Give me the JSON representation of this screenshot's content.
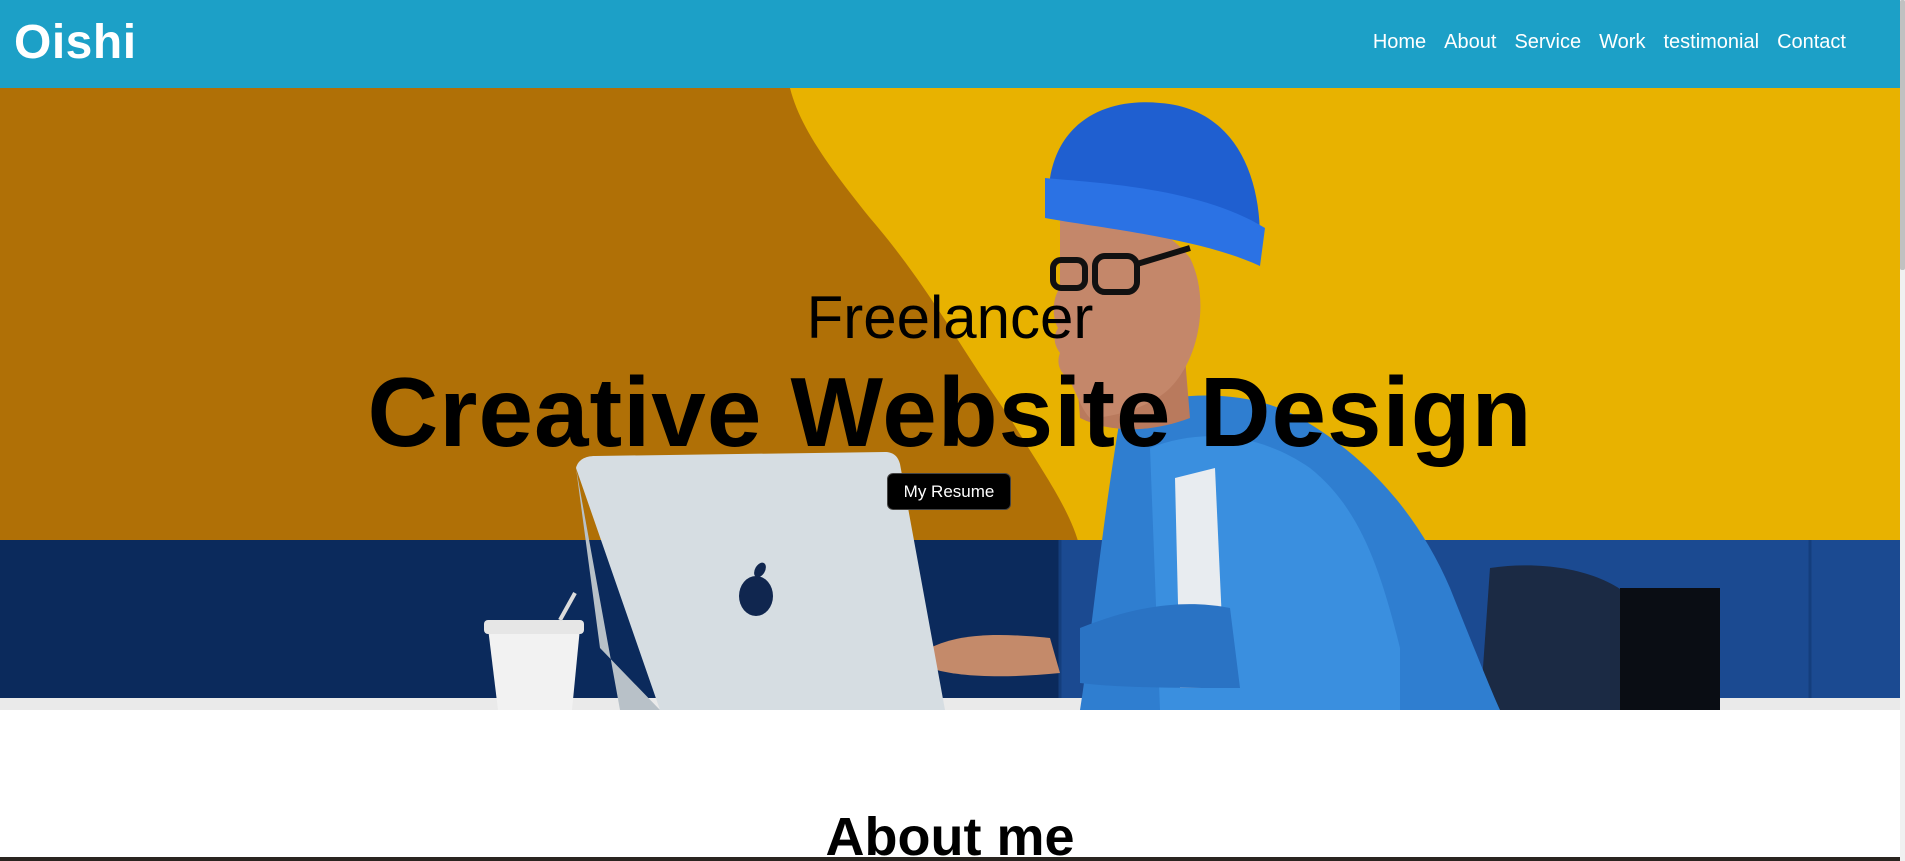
{
  "brand": {
    "logo": "Oishi"
  },
  "nav": {
    "items": [
      {
        "label": "Home"
      },
      {
        "label": "About"
      },
      {
        "label": "Service"
      },
      {
        "label": "Work"
      },
      {
        "label": "testimonial"
      },
      {
        "label": "Contact"
      }
    ]
  },
  "hero": {
    "subtitle": "Freelancer",
    "title": "Creative Website Design",
    "button_label": "My Resume"
  },
  "about": {
    "title": "About me"
  },
  "colors": {
    "navbar": "#1ca0c7",
    "hero_yellow": "#e9b300",
    "hero_blue": "#0d2a5e",
    "button": "#000000"
  }
}
